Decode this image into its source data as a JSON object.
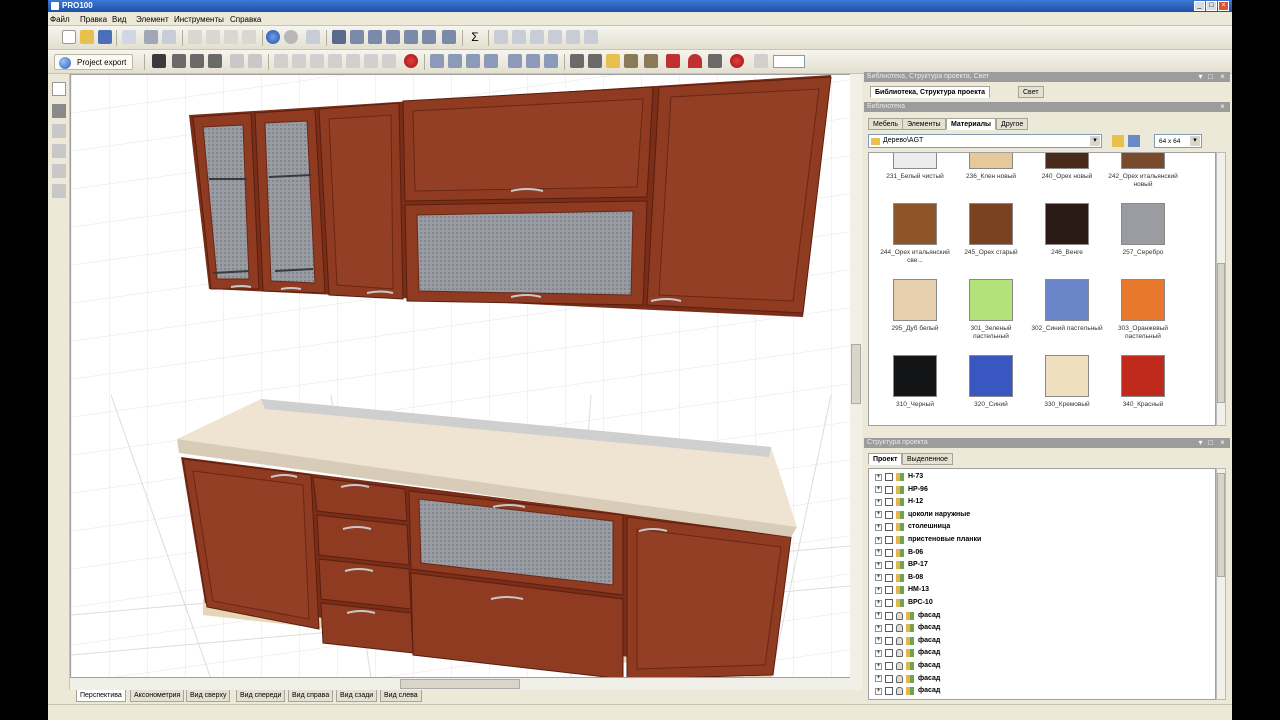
{
  "window": {
    "title": "PRO100"
  },
  "menu": [
    "Файл",
    "Правка",
    "Вид",
    "Элемент",
    "Инструменты",
    "Справка"
  ],
  "toolbar2": {
    "project_export": "Project export"
  },
  "view_tabs": [
    "Перспектива",
    "Аксонометрия",
    "Вид сверху",
    "Вид спереди",
    "Вид справа",
    "Вид сзади",
    "Вид слева"
  ],
  "library_panel": {
    "title": "Библиотека, Структура проекта, Свет",
    "tabs": [
      "Библиотека, Структура проекта",
      "Свет"
    ],
    "sub_title": "Библиотека",
    "sub_tabs": [
      "Мебель",
      "Элементы",
      "Материалы",
      "Другое"
    ],
    "path": "Дерево\\AGT",
    "size": "64 x 64",
    "materials": [
      {
        "label": "231_Белый чистый",
        "color": "#ececec"
      },
      {
        "label": "236_Клен новый",
        "color": "#e6c99a"
      },
      {
        "label": "240_Орех новый",
        "color": "#4a2a1a"
      },
      {
        "label": "242_Орех итальянский новый",
        "color": "#7a4a2c"
      },
      {
        "label": "244_Орех итальянский све...",
        "color": "#8e5528"
      },
      {
        "label": "245_Орех старый",
        "color": "#7a4220"
      },
      {
        "label": "246_Венге",
        "color": "#2a1a16"
      },
      {
        "label": "257_Серебро",
        "color": "#9a9ca2"
      },
      {
        "label": "295_Дуб белый",
        "color": "#e6cfac"
      },
      {
        "label": "301_Зеленый пастельный",
        "color": "#b4e27a"
      },
      {
        "label": "302_Синий пастельный",
        "color": "#6a86c8"
      },
      {
        "label": "303_Оранжевый пастельный",
        "color": "#e8782c"
      },
      {
        "label": "310_Черный",
        "color": "#121416"
      },
      {
        "label": "320_Синий",
        "color": "#3a56c0"
      },
      {
        "label": "330_Кремовый",
        "color": "#eedfbe"
      },
      {
        "label": "340_Красный",
        "color": "#c02a1c"
      }
    ]
  },
  "structure_panel": {
    "title": "Структура проекта",
    "tabs": [
      "Проект",
      "Выделенное"
    ],
    "items": [
      {
        "label": "Н-73",
        "lock": false
      },
      {
        "label": "НР-96",
        "lock": false
      },
      {
        "label": "Н-12",
        "lock": false
      },
      {
        "label": "цоколи наружные",
        "lock": false
      },
      {
        "label": "столешница",
        "lock": false
      },
      {
        "label": "пристеновые планки",
        "lock": false
      },
      {
        "label": "В-06",
        "lock": false
      },
      {
        "label": "ВР-17",
        "lock": false
      },
      {
        "label": "В-08",
        "lock": false
      },
      {
        "label": "НМ-13",
        "lock": false
      },
      {
        "label": "ВРС-10",
        "lock": false
      },
      {
        "label": "фасад",
        "lock": true
      },
      {
        "label": "фасад",
        "lock": true
      },
      {
        "label": "фасад",
        "lock": true
      },
      {
        "label": "фасад",
        "lock": true
      },
      {
        "label": "фасад",
        "lock": true
      },
      {
        "label": "фасад",
        "lock": true
      },
      {
        "label": "фасад",
        "lock": true
      }
    ]
  },
  "colors": {
    "cabinet": "#8b3a22",
    "countertop": "#efe4d2",
    "accent": "#2b5fbd"
  }
}
